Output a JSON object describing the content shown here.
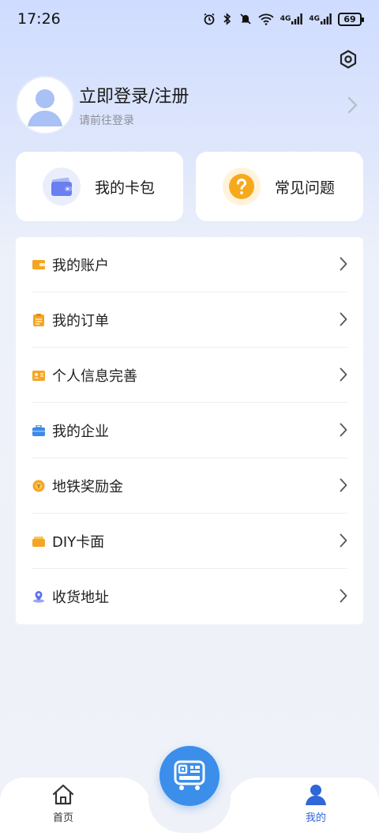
{
  "status_bar": {
    "time": "17:26",
    "network_1": "4G",
    "network_2": "4G",
    "battery": "69"
  },
  "profile": {
    "title": "立即登录/注册",
    "subtitle": "请前往登录"
  },
  "quick_cards": [
    {
      "label": "我的卡包",
      "icon": "wallet-icon"
    },
    {
      "label": "常见问题",
      "icon": "question-icon"
    }
  ],
  "menu": {
    "items": [
      {
        "label": "我的账户",
        "icon": "account-icon"
      },
      {
        "label": "我的订单",
        "icon": "order-icon"
      },
      {
        "label": "个人信息完善",
        "icon": "id-card-icon"
      },
      {
        "label": "我的企业",
        "icon": "briefcase-icon"
      },
      {
        "label": "地铁奖励金",
        "icon": "coin-icon"
      },
      {
        "label": "DIY卡面",
        "icon": "card-face-icon"
      },
      {
        "label": "收货地址",
        "icon": "location-icon"
      }
    ]
  },
  "bottom_nav": {
    "home_label": "首页",
    "mine_label": "我的",
    "active": "mine"
  },
  "colors": {
    "accent_blue": "#3b8eea",
    "active_tab": "#2f66d8",
    "menu_icon_orange": "#f5a524",
    "menu_icon_blue": "#3d8ae8"
  }
}
